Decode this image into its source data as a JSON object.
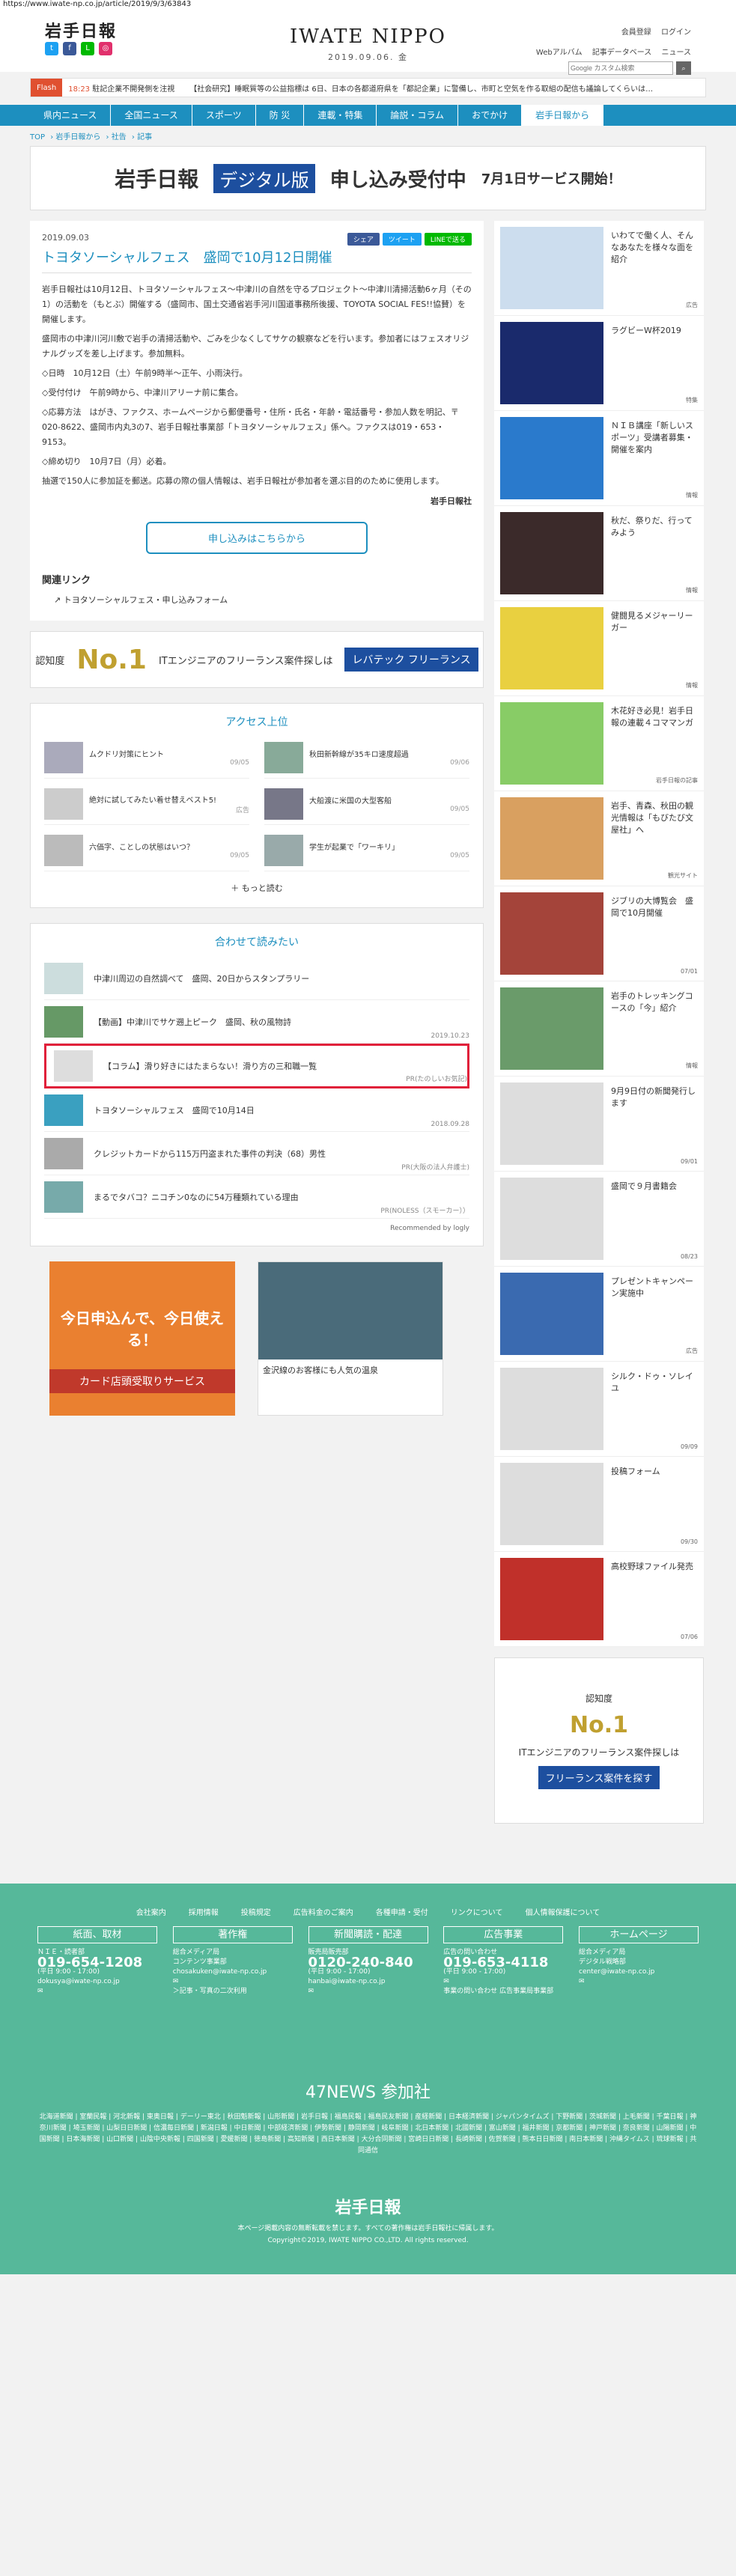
{
  "url": "https://www.iwate-np.co.jp/article/2019/9/3/63843",
  "header": {
    "logo_jp": "岩手日報",
    "brand_en": "IWATE NIPPO",
    "date": "2019.09.06. 金",
    "links": [
      "会員登録",
      "ログイン"
    ],
    "sub_links": [
      "Webアルバム",
      "記事データベース",
      "ニュース"
    ],
    "search_placeholder": "Google カスタム検索"
  },
  "flash": {
    "tag": "Flash",
    "items": [
      {
        "time": "18:23",
        "text": "駐記企業不開発側を注視"
      },
      {
        "time": "",
        "text": "【社会研究】睡眠質等の公益指標は 6日、日本の各都道府県を「都記企業」に警備し、市町と空気を作る取組の配信も議論してくらいは…"
      }
    ]
  },
  "nav": [
    "県内ニュース",
    "全国ニュース",
    "スポーツ",
    "防 災",
    "連載・特集",
    "論説・コラム",
    "おでかけ",
    "岩手日報から"
  ],
  "breadcrumb": [
    "TOP",
    "岩手日報から",
    "社告",
    "記事"
  ],
  "banner": {
    "t1": "岩手日報",
    "t2": "デジタル版",
    "t3": "申し込み受付中",
    "t4": "7月1日サービス開始！"
  },
  "article": {
    "date": "2019.09.03",
    "title": "トヨタソーシャルフェス　盛岡で10月12日開催",
    "share": [
      "シェア",
      "ツイート",
      "LINEで送る"
    ],
    "paragraphs": [
      "岩手日報社は10月12日、トヨタソーシャルフェス〜中津川の自然を守るプロジェクト〜中津川清掃活動6ヶ月（その1）の活動を（もとぶ）開催する（盛岡市、国土交通省岩手河川国道事務所後援、TOYOTA SOCIAL FES!!協賛）を開催します。",
      "盛岡市の中津川河川敷で岩手の清掃活動や、ごみを少なくしてサケの観察などを行います。参加者にはフェスオリジナルグッズを差し上げます。参加無料。",
      "◇日時　10月12日（土）午前9時半〜正午、小雨決行。",
      "◇受付付け　午前9時から、中津川アリーナ前に集合。",
      "◇応募方法　はがき、ファクス、ホームページから郵便番号・住所・氏名・年齢・電話番号・参加人数を明記、〒020-8622、盛岡市内丸3の7、岩手日報社事業部「トヨタソーシャルフェス」係へ。ファクスは019・653・9153。",
      "◇締め切り　10月7日（月）必着。",
      "抽選で150人に参加証を郵送。応募の際の個人情報は、岩手日報社が参加者を選ぶ目的のために使用します。"
    ],
    "source": "岩手日報社",
    "apply_label": "申し込みはこちらから",
    "related_heading": "関連リンク",
    "related_link": "トヨタソーシャルフェス・申し込みフォーム"
  },
  "ad_wide": {
    "a": "認知度",
    "n1": "No.1",
    "t": "ITエンジニアのフリーランス案件探しは",
    "lv": "レバテック フリーランス"
  },
  "access": {
    "title": "アクセス上位",
    "items": [
      {
        "text": "ムクドリ対策にヒント",
        "date": "09/05"
      },
      {
        "text": "秋田新幹線が35キロ速度超過",
        "date": "09/06"
      },
      {
        "text": "絶対に試してみたい着せ替えベスト5!",
        "date": "広告"
      },
      {
        "text": "大船渡に米国の大型客船",
        "date": "09/05"
      },
      {
        "text": "六価字、ことしの状態はいつ？",
        "date": "09/05"
      },
      {
        "text": "学生が起業で「ワーキリ」",
        "date": "09/05"
      }
    ],
    "more": "もっと読む"
  },
  "recommend": {
    "title": "合わせて読みたい",
    "items": [
      {
        "text": "中津川周辺の自然調べて　盛岡、20日からスタンプラリー",
        "meta": ""
      },
      {
        "text": "【動画】中津川でサケ遡上ピーク　盛岡、秋の風物詩",
        "meta": "2019.10.23"
      },
      {
        "text": "【コラム】滑り好きにはたまらない！滑り方の三和職一覧",
        "meta": "PR(たのしいお気記)"
      },
      {
        "text": "トヨタソーシャルフェス　盛岡で10月14日",
        "meta": "2018.09.28"
      },
      {
        "text": "クレジットカードから115万円盗まれた事件の判決（68）男性",
        "meta": "PR(大阪の法人弁護士)"
      },
      {
        "text": "まるでタバコ？ニコチン0なのに54万種類れている理由",
        "meta": "PR(NOLESS（スモーカー））"
      }
    ],
    "powered": "Recommended by logly"
  },
  "ad_aeon": {
    "a1": "今日申込んで、今日使える！",
    "a2": "カード店頭受取りサービス"
  },
  "ad_onsen": {
    "t": "金沢線のお客様にも人気の温泉"
  },
  "side": [
    {
      "text": "いわてで働く人、そんなあなたを様々な面を紹介",
      "cat": "広告"
    },
    {
      "text": "ラグビーW杯2019",
      "cat": "特集"
    },
    {
      "text": "ＮＩＢ講座「新しいスポーツ」受講者募集・開催を案内",
      "cat": "情報"
    },
    {
      "text": "秋だ、祭りだ、行ってみよう",
      "cat": "情報"
    },
    {
      "text": "健闘見るメジャーリーガー",
      "cat": "情報"
    },
    {
      "text": "木花好き必見！岩手日報の連載４コママンガ",
      "cat": "岩手日報の記事"
    },
    {
      "text": "岩手、青森、秋田の観光情報は「もびたび文屋社」へ",
      "cat": "観光サイト"
    },
    {
      "text": "ジブリの大博覧会　盛岡で10月開催",
      "cat": "07/01"
    },
    {
      "text": "岩手のトレッキングコースの「今」紹介",
      "cat": "情報"
    },
    {
      "text": "9月9日付の新聞発行します",
      "cat": "09/01"
    },
    {
      "text": "盛岡で９月書籍会",
      "cat": "08/23"
    },
    {
      "text": "プレゼントキャンペーン実施中",
      "cat": "広告"
    },
    {
      "text": "シルク・ドゥ・ソレイユ",
      "cat": "09/09"
    },
    {
      "text": "投稿フォーム",
      "cat": "09/30"
    },
    {
      "text": "高校野球ファイル発売",
      "cat": "07/06"
    }
  ],
  "side_ad": {
    "a": "認知度",
    "n1": "No.1",
    "t": "ITエンジニアのフリーランス案件探しは",
    "lv": "フリーランス案件を探す"
  },
  "footer": {
    "links": [
      "会社案内",
      "採用情報",
      "投稿規定",
      "広告料金のご案内",
      "各種申請・受付",
      "リンクについて",
      "個人情報保護について"
    ],
    "cols": [
      {
        "h": "紙面、取材",
        "l1": "ＮＩＥ・読者部",
        "tel": "019-654-1208",
        "l2": "(平日 9:00 - 17:00)",
        "l3": "dokusya@iwate-np.co.jp"
      },
      {
        "h": "著作権",
        "l1": "総合メディア局",
        "tel": "コンテンツ事業部",
        "l2": "chosakuken@iwate-np.co.jp",
        "l3": "＞記事・写真の二次利用"
      },
      {
        "h": "新聞購読・配達",
        "l1": "販売局販売部",
        "tel": "0120-240-840",
        "l2": "(平日 9:00 - 17:00)",
        "l3": "hanbai@iwate-np.co.jp"
      },
      {
        "h": "広告事業",
        "l1": "広告の問い合わせ",
        "tel": "019-653-4118",
        "l2": "(平日 9:00 - 17:00)",
        "l3": "事業の問い合わせ 広告事業局事業部"
      },
      {
        "h": "ホームページ",
        "l1": "総合メディア局",
        "tel": "デジタル戦略部",
        "l2": "center@iwate-np.co.jp",
        "l3": ""
      }
    ],
    "news_title": "47NEWS 参加社",
    "news_list": "北海道新聞 | 室蘭民報 | 河北新報 | 東奥日報 | デーリー東北 | 秋田魁新報 | 山形新聞 | 岩手日報 | 福島民報 | 福島民友新聞 | 産経新聞 | 日本経済新聞 | ジャパンタイムズ | 下野新聞 | 茨城新聞 | 上毛新聞 | 千葉日報 | 神奈川新聞 | 埼玉新聞 | 山梨日日新聞 | 信濃毎日新聞 | 新潟日報 | 中日新聞 | 中部経済新聞 | 伊勢新聞 | 静岡新聞 | 岐阜新聞 | 北日本新聞 | 北國新聞 | 富山新聞 | 福井新聞 | 京都新聞 | 神戸新聞 | 奈良新聞 | 山陽新聞 | 中国新聞 | 日本海新聞 | 山口新聞 | 山陰中央新報 | 四国新聞 | 愛媛新聞 | 徳島新聞 | 高知新聞 | 西日本新聞 | 大分合同新聞 | 宮崎日日新聞 | 長崎新聞 | 佐賀新聞 | 熊本日日新聞 | 南日本新聞 | 沖縄タイムス | 琉球新報 | 共同通信",
    "logo": "岩手日報",
    "notice": "本ページ掲載内容の無断転載を禁じます。すべての著作権は岩手日報社に帰属します。",
    "copyright": "Copyright©2019, IWATE NIPPO CO.,LTD. All rights reserved."
  },
  "colors": {
    "accent": "#1d8fbf",
    "footer": "#56b89a",
    "highlight": "#e0203a"
  }
}
